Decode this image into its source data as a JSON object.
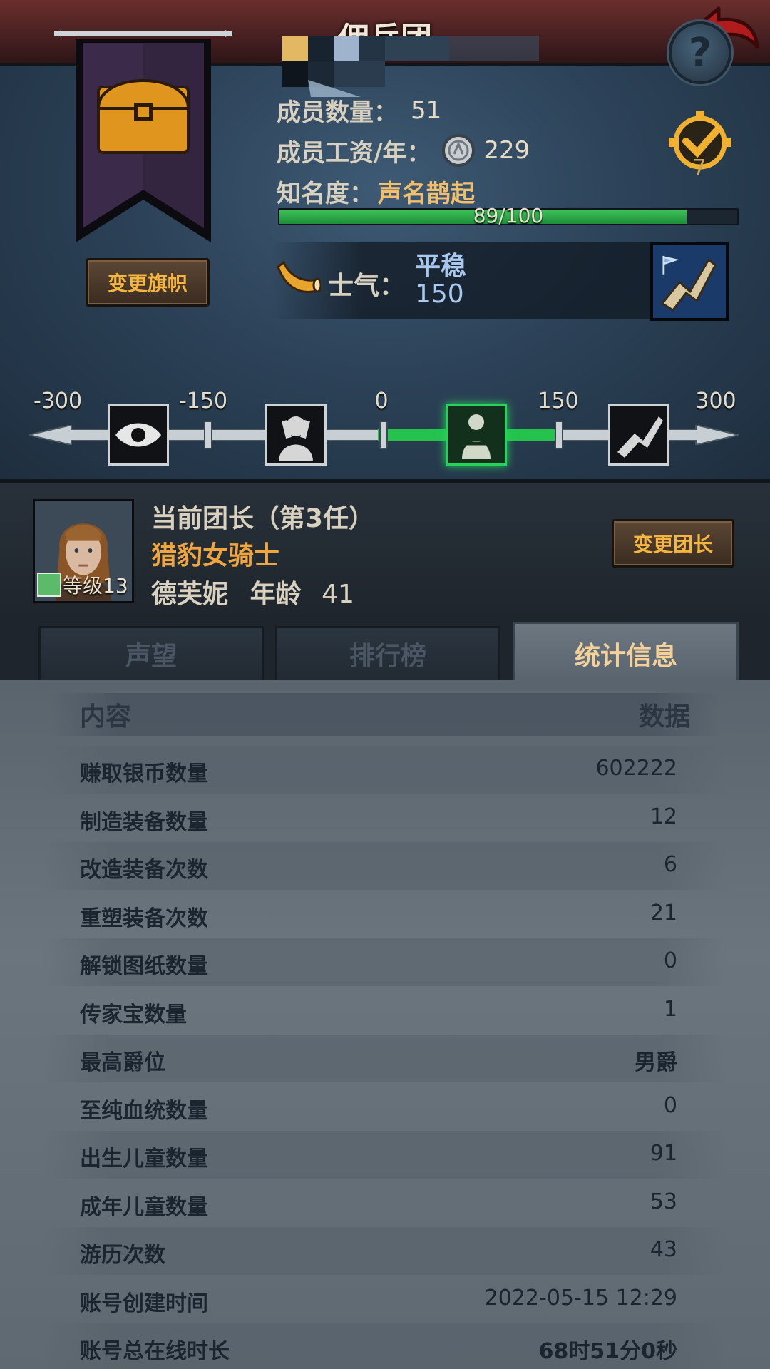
{
  "header": {
    "title": "佣兵团"
  },
  "guild": {
    "change_flag_label": "变更旗帜",
    "members_label": "成员数量：",
    "members_value": "51",
    "wage_label": "成员工资/年：",
    "wage_value": "229",
    "fame_label": "知名度：",
    "fame_value": "声名鹊起",
    "fame_progress_text": "89/100",
    "fame_progress_fraction": 0.89,
    "badge_count": "7",
    "morale_label": "士气：",
    "morale_state": "平稳",
    "morale_value": "150",
    "morale_ticks": [
      "-300",
      "-150",
      "0",
      "150",
      "300"
    ],
    "morale_current": 150
  },
  "leader": {
    "title": "当前团长（第3任）",
    "class_name": "猎豹女骑士",
    "level_label": "等级13",
    "name": "德芙妮",
    "age_label": "年龄",
    "age_value": "41",
    "change_leader_label": "变更团长"
  },
  "tabs": [
    {
      "label": "声望",
      "active": false
    },
    {
      "label": "排行榜",
      "active": false
    },
    {
      "label": "统计信息",
      "active": true
    }
  ],
  "table": {
    "header_content": "内容",
    "header_data": "数据",
    "rows": [
      {
        "label": "赚取银币数量",
        "value": "602222"
      },
      {
        "label": "制造装备数量",
        "value": "12"
      },
      {
        "label": "改造装备次数",
        "value": "6"
      },
      {
        "label": "重塑装备次数",
        "value": "21"
      },
      {
        "label": "解锁图纸数量",
        "value": "0"
      },
      {
        "label": "传家宝数量",
        "value": "1"
      },
      {
        "label": "最高爵位",
        "value": "男爵"
      },
      {
        "label": "至纯血统数量",
        "value": "0"
      },
      {
        "label": "出生儿童数量",
        "value": "91"
      },
      {
        "label": "成年儿童数量",
        "value": "53"
      },
      {
        "label": "游历次数",
        "value": "43"
      },
      {
        "label": "账号创建时间",
        "value": "2022-05-15 12:29"
      },
      {
        "label": "账号总在线时长",
        "value": "68时51分0秒"
      }
    ]
  },
  "colors": {
    "accent_gold": "#f4b640",
    "morale_green": "#25d35a",
    "fame_bar": "#3dc35a",
    "header_red": "#6a2e2c"
  },
  "icons": {
    "back": "back-arrow-icon",
    "help": "question-icon",
    "banner": "treasure-chest-icon",
    "coin": "silver-coin-icon",
    "horn": "horn-icon",
    "badge": "rank-badge-icon"
  }
}
